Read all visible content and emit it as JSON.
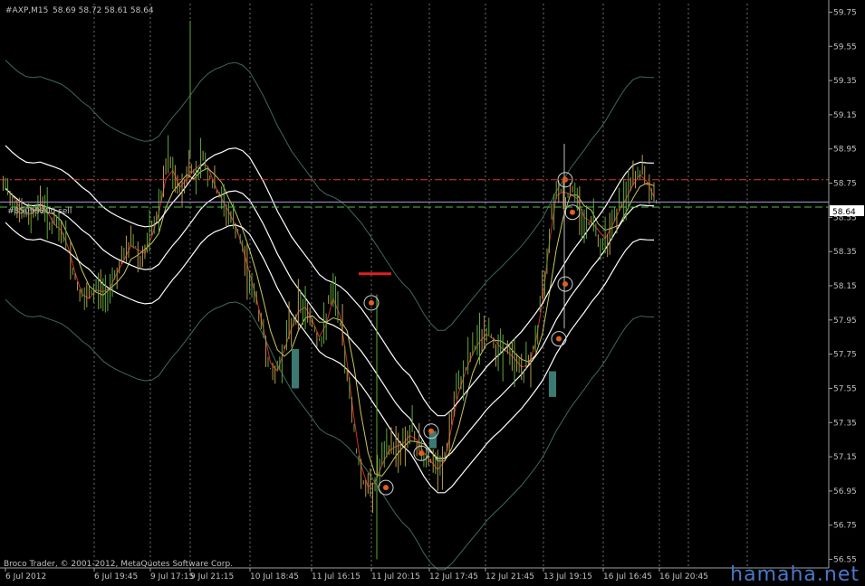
{
  "header": {
    "symbol_label": "#AXP,M15",
    "ohlc": "58.69 58.72 58.61 58.64"
  },
  "order_label": "#85099200 sell",
  "copyright": "Broco Trader, © 2001-2012, MetaQuotes Software Corp.",
  "watermark": "hamaha.net",
  "price_marker": "58.64",
  "colors": {
    "background": "#000000",
    "grid": "#c8c8c8",
    "axis": "#a0a0a0",
    "price_labels": "#c0c0c0",
    "bull_bar": "#5fa83a",
    "bear_bar": "#b89a4a",
    "fast_ma": "#d03030",
    "slow_ma": "#c8c860",
    "bands_outer": "#3c6a5a",
    "bands_inner": "#ffffff",
    "order_line": "#d04020",
    "bid_line": "#50c040",
    "current_line": "#a0a0d0",
    "histogram": "#3a7a72"
  },
  "chart_data": {
    "type": "candlestick",
    "symbol": "#AXP",
    "timeframe": "M15",
    "last_bar": {
      "open": 58.69,
      "high": 58.72,
      "low": 58.61,
      "close": 58.64
    },
    "y_ticks": [
      "59.75",
      "59.55",
      "59.35",
      "59.15",
      "58.95",
      "58.75",
      "58.55",
      "58.35",
      "58.15",
      "57.95",
      "57.75",
      "57.55",
      "57.35",
      "57.15",
      "56.95",
      "56.75",
      "56.55"
    ],
    "ylim": [
      56.5,
      59.8
    ],
    "x_ticks": [
      "6 Jul 2012",
      "6 Jul 19:45",
      "9 Jul 17:15",
      "9 Jul 21:15",
      "10 Jul 18:45",
      "11 Jul 16:15",
      "11 Jul 20:15",
      "12 Jul 17:45",
      "12 Jul 21:45",
      "13 Jul 19:15",
      "16 Jul 16:45",
      "16 Jul 20:45"
    ],
    "horizontal_levels": [
      {
        "name": "sell order",
        "value": 58.77
      },
      {
        "name": "bid",
        "value": 58.61
      },
      {
        "name": "current",
        "value": 58.64
      }
    ],
    "close_path": [
      58.72,
      58.64,
      58.58,
      58.55,
      58.6,
      58.65,
      58.52,
      58.5,
      58.45,
      58.3,
      58.15,
      58.05,
      58.1,
      58.15,
      58.08,
      58.2,
      58.25,
      58.35,
      58.42,
      58.3,
      58.38,
      58.5,
      58.65,
      58.9,
      58.75,
      58.7,
      58.85,
      58.8,
      58.92,
      58.78,
      58.7,
      58.62,
      58.55,
      58.45,
      58.3,
      58.15,
      58.0,
      57.8,
      57.6,
      57.7,
      57.85,
      57.95,
      58.05,
      58.0,
      57.9,
      57.8,
      58.05,
      58.1,
      57.85,
      57.55,
      57.2,
      57.0,
      56.95,
      57.05,
      57.15,
      57.22,
      57.2,
      57.25,
      57.3,
      57.2,
      57.15,
      57.1,
      57.05,
      57.2,
      57.45,
      57.6,
      57.7,
      57.8,
      57.85,
      57.88,
      57.8,
      57.78,
      57.75,
      57.7,
      57.65,
      57.72,
      57.9,
      58.2,
      58.6,
      58.75,
      58.65,
      58.72,
      58.6,
      58.5,
      58.55,
      58.4,
      58.45,
      58.55,
      58.62,
      58.7,
      58.78,
      58.82,
      58.7,
      58.64
    ]
  }
}
